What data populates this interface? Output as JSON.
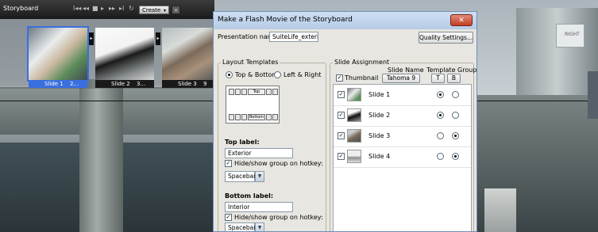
{
  "storyboard": {
    "title": "Storyboard",
    "controls": [
      "I◂◂",
      "◂◂",
      "■",
      "▸",
      "▸▸",
      "▸I",
      "↻"
    ],
    "create_label": "Create",
    "create_arrow": "▾",
    "close_glyph": "×",
    "slides": [
      {
        "label": "Slide 1",
        "next": "2...",
        "selected": true
      },
      {
        "label": "Slide 2",
        "next": "3...",
        "selected": false
      },
      {
        "label": "Slide 3",
        "next": "9",
        "selected": false
      }
    ]
  },
  "scene": {
    "cube_label": "RIGHT"
  },
  "dialog": {
    "title": "Make a Flash Movie of the Storyboard",
    "close_glyph": "✕",
    "presentation_name_label": "Presentation name:",
    "presentation_name_value": "SuiteLife_exterio",
    "quality_button": "Quality Settings...",
    "layout_templates": {
      "title": "Layout Templates",
      "options": [
        {
          "label": "Top & Bottom",
          "selected": true
        },
        {
          "label": "Left & Right",
          "selected": false
        }
      ],
      "preview_top": "Top",
      "preview_bottom": "Bottom"
    },
    "top_label": {
      "heading": "Top label:",
      "value": "Exterior",
      "hotkey_checkbox": "Hide/show group on hotkey:",
      "hotkey_checked": true,
      "hotkey_value": "Spacebar",
      "dropdown_arrow": "▼"
    },
    "bottom_label": {
      "heading": "Bottom label:",
      "value": "Interior",
      "hotkey_checkbox": "Hide/show group on hotkey:",
      "hotkey_checked": true,
      "hotkey_value": "Spacebar",
      "dropdown_arrow": "▼"
    },
    "slide_assignment": {
      "title": "Slide Assignment",
      "thumbnail_label": "Thumbnail",
      "thumbnail_checked": true,
      "slide_name_header": "Slide Name",
      "font_button": "Tahoma 9",
      "template_group_header": "Template Group",
      "group_t": "T",
      "group_b": "B",
      "check_glyph": "✓",
      "slides": [
        {
          "name": "Slide 1",
          "checked": true,
          "group": "T"
        },
        {
          "name": "Slide 2",
          "checked": true,
          "group": "T"
        },
        {
          "name": "Slide 3",
          "checked": true,
          "group": "B"
        },
        {
          "name": "Slide 4",
          "checked": true,
          "group": "B"
        }
      ]
    }
  },
  "colors": {
    "selection_blue": "#3a6fe0",
    "dialog_bg": "#e8e6e0",
    "title_gradient_top": "#cfdff2",
    "close_red": "#c23e24"
  }
}
